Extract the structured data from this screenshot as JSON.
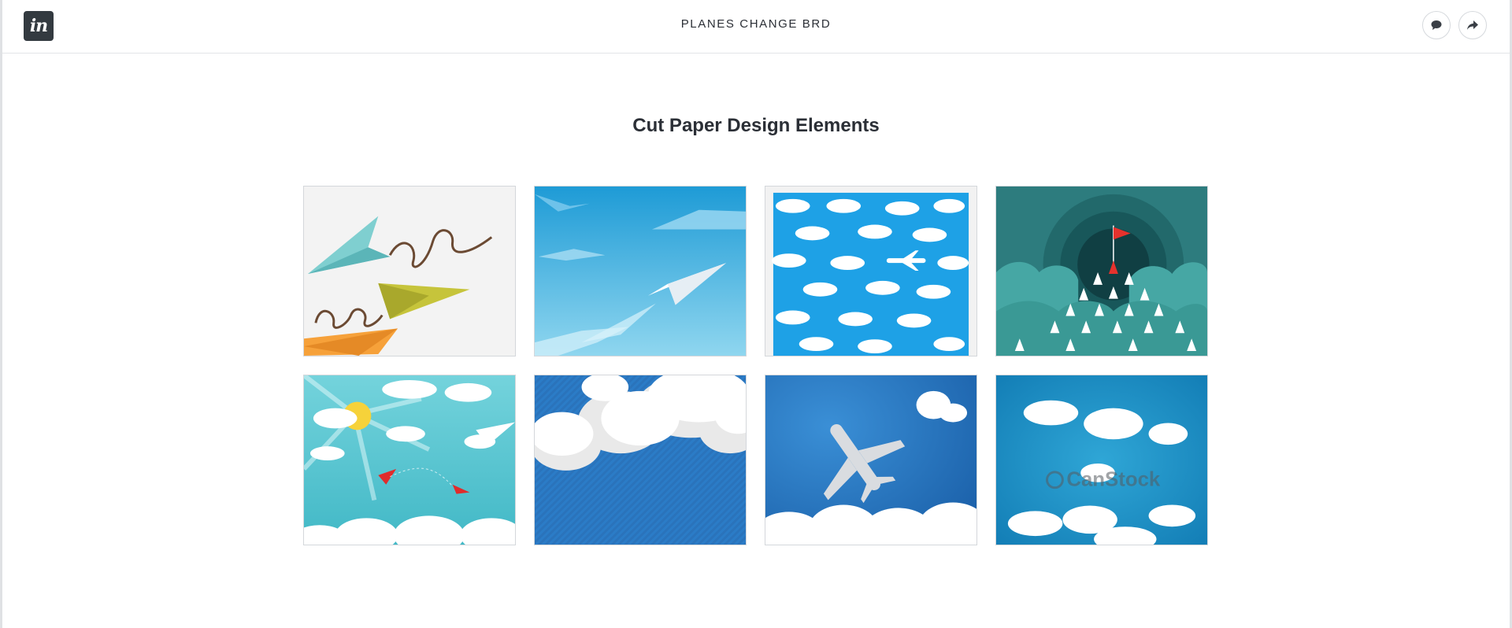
{
  "header": {
    "logo_text": "in",
    "project_title": "PLANES CHANGE BRD",
    "comment_icon": "speech-bubble-icon",
    "share_icon": "share-arrow-icon"
  },
  "page": {
    "title": "Cut Paper Design Elements"
  },
  "gallery": {
    "watermark_text": "CanStock",
    "thumbnails": [
      {
        "name": "paper-planes-colorful"
      },
      {
        "name": "paper-plane-blue-sky"
      },
      {
        "name": "clouds-pattern-airplane"
      },
      {
        "name": "paper-planes-teal-flag"
      },
      {
        "name": "sun-clouds-red-planes"
      },
      {
        "name": "paper-clouds-striped-blue"
      },
      {
        "name": "airplane-blue-clouds"
      },
      {
        "name": "paper-clouds-canstock"
      }
    ]
  },
  "colors": {
    "logo_bg": "#333a40",
    "sky_blue": "#29a3df",
    "deep_blue": "#1e6fb8",
    "teal_dark": "#1f5f63"
  }
}
